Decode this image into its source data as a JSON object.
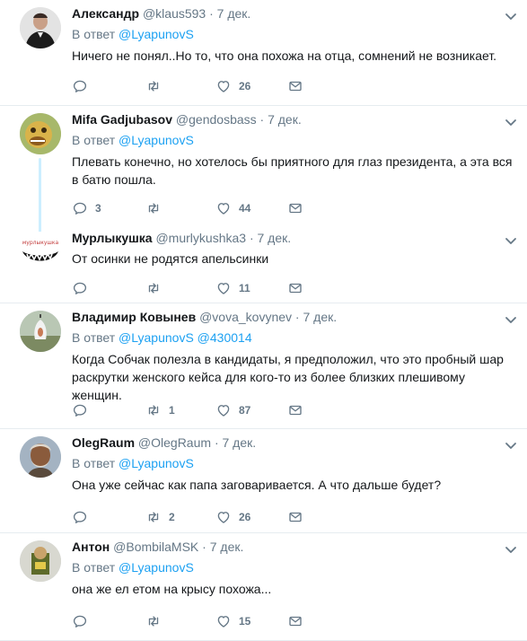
{
  "tweets": [
    {
      "name": "Александр",
      "handle": "@klaus593",
      "time": "· 7 дек.",
      "reply_prefix": "В ответ ",
      "reply_to": "@LyapunovS",
      "reply_to2": "",
      "text": "Ничего не понял..Но то, что она похожа на отца, сомнений не возникает.",
      "replies": "",
      "retweets": "",
      "likes": "26"
    },
    {
      "name": "Mifa Gadjubasov",
      "handle": "@gendosbass",
      "time": "· 7 дек.",
      "reply_prefix": "В ответ ",
      "reply_to": "@LyapunovS",
      "reply_to2": "",
      "text": "Плевать конечно, но хотелось бы приятного для глаз президента, а эта вся в батю пошла.",
      "replies": "3",
      "retweets": "",
      "likes": "44"
    },
    {
      "name": "Мурлыкушка",
      "handle": "@murlykushka3",
      "time": "· 7 дек.",
      "reply_prefix": "",
      "reply_to": "",
      "reply_to2": "",
      "text": "От осинки не родятся апельсинки",
      "replies": "",
      "retweets": "",
      "likes": "11",
      "avatar_text": "мурлыкушка"
    },
    {
      "name": "Владимир Ковынев",
      "handle": "@vova_kovynev",
      "time": "· 7 дек.",
      "reply_prefix": "В ответ ",
      "reply_to": "@LyapunovS",
      "reply_to2": " @430014",
      "text": "Когда Собчак полезла в кандидаты, я предположил, что это пробный шар раскрутки женского кейса для кого-то из более близких плешивому женщин.",
      "replies": "",
      "retweets": "1",
      "likes": "87"
    },
    {
      "name": "OlegRaum",
      "handle": "@OlegRaum",
      "time": "· 7 дек.",
      "reply_prefix": "В ответ ",
      "reply_to": "@LyapunovS",
      "reply_to2": "",
      "text": "Она уже сейчас как папа заговаривается. А что дальше будет?",
      "replies": "",
      "retweets": "2",
      "likes": "26"
    },
    {
      "name": "Антон",
      "handle": "@BombilaMSK",
      "time": "· 7 дек.",
      "reply_prefix": "В ответ ",
      "reply_to": "@LyapunovS",
      "reply_to2": "",
      "text": "она же ел етом на крысу похожа...",
      "replies": "",
      "retweets": "",
      "likes": "15"
    }
  ],
  "colors": {
    "link": "#1da1f2",
    "muted": "#657786",
    "text": "#14171a",
    "border": "#e6ecf0"
  }
}
